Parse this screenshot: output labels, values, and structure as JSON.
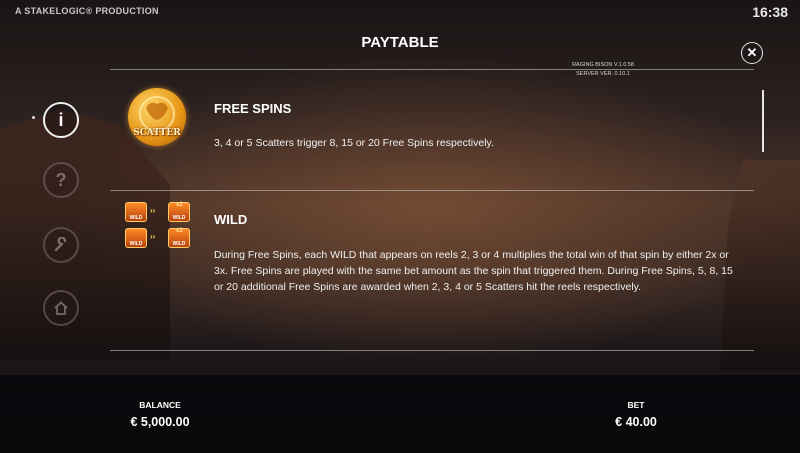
{
  "header": {
    "production_label": "A STAKELOGIC® PRODUCTION",
    "clock": "16:38",
    "title": "PAYTABLE",
    "version_line1": "RAGING BISON V.1.0.58",
    "version_line2": "SERVER VER. 0.10.1",
    "close_icon": "close-icon"
  },
  "nav": {
    "items": [
      {
        "icon": "info-icon",
        "glyph": "i",
        "active": true
      },
      {
        "icon": "help-icon",
        "glyph": "?",
        "active": false
      },
      {
        "icon": "wrench-icon",
        "glyph": "🔧",
        "active": false
      },
      {
        "icon": "home-icon",
        "glyph": "⌂",
        "active": false
      }
    ]
  },
  "sections": {
    "free_spins": {
      "title": "FREE SPINS",
      "text": "3, 4 or 5 Scatters trigger 8, 15 or 20 Free Spins respectively.",
      "icon_label": "SCATTER"
    },
    "wild": {
      "title": "WILD",
      "text": "During Free Spins, each WILD that appears on reels 2, 3 or 4 multiplies the total win of that spin by either 2x or 3x. Free Spins are played with the same bet amount as the spin that triggered them. During Free Spins, 5, 8, 15 or 20 additional Free Spins are awarded when 2, 3, 4 or 5 Scatters hit the reels respectively.",
      "tile_label": "WILD",
      "mult_2": "x2",
      "mult_3": "x3"
    }
  },
  "footer": {
    "balance_label": "BALANCE",
    "balance_value": "€ 5,000.00",
    "bet_label": "BET",
    "bet_value": "€ 40.00"
  },
  "colors": {
    "accent_gold": "#e69414",
    "wild_orange": "#ff8a2a",
    "text": "#ffffff"
  }
}
